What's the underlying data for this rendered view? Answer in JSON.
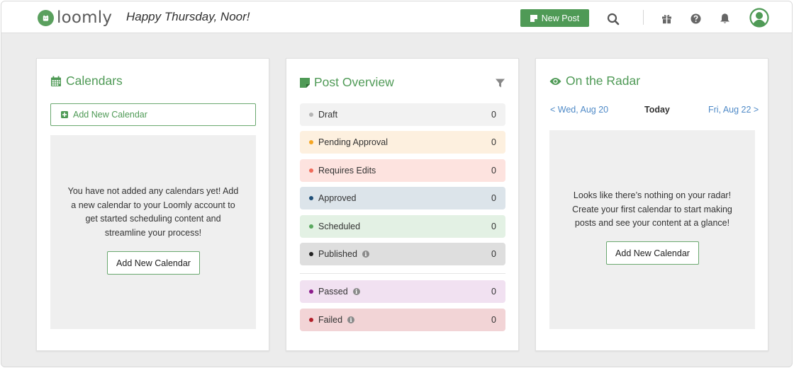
{
  "app": {
    "logo_text": "loomly",
    "greeting": "Happy Thursday, Noor!"
  },
  "toolbar": {
    "new_post_label": "New Post"
  },
  "icons": {
    "search": "search-icon",
    "gift": "gift-icon",
    "help": "help-icon",
    "bell": "bell-icon",
    "user": "user-icon"
  },
  "colors": {
    "brand_green": "#4f9a56",
    "link_blue": "#4f8ac7",
    "page_bg": "#ececec"
  },
  "calendars": {
    "title": "Calendars",
    "add_link_label": "Add New Calendar",
    "empty_message": "You have not added any calendars yet! Add a new calendar to your Loomly account to get started scheduling content and streamline your process!",
    "add_button_label": "Add New Calendar"
  },
  "post_overview": {
    "title": "Post Overview",
    "statuses": [
      {
        "label": "Draft",
        "count": "0",
        "bg": "#f2f2f2",
        "dot": "#b5b5b5"
      },
      {
        "label": "Pending Approval",
        "count": "0",
        "bg": "#fdf0df",
        "dot": "#f5a623"
      },
      {
        "label": "Requires Edits",
        "count": "0",
        "bg": "#fde3df",
        "dot": "#f06b5a"
      },
      {
        "label": "Approved",
        "count": "0",
        "bg": "#dce4ea",
        "dot": "#1f4f78"
      },
      {
        "label": "Scheduled",
        "count": "0",
        "bg": "#e3f1e4",
        "dot": "#5aa85f"
      },
      {
        "label": "Published",
        "count": "0",
        "bg": "#dedede",
        "dot": "#222222",
        "info": true
      },
      {
        "label": "Passed",
        "count": "0",
        "bg": "#f1e1f1",
        "dot": "#8b1c8b",
        "info": true
      },
      {
        "label": "Failed",
        "count": "0",
        "bg": "#f2d4d6",
        "dot": "#b11f2a",
        "info": true
      }
    ]
  },
  "radar": {
    "title": "On the Radar",
    "prev_label": "< Wed, Aug 20",
    "today_label": "Today",
    "next_label": "Fri, Aug 22 >",
    "empty_message": "Looks like there’s nothing on your radar! Create your first calendar to start making posts and see your content at a glance!",
    "add_button_label": "Add New Calendar"
  }
}
